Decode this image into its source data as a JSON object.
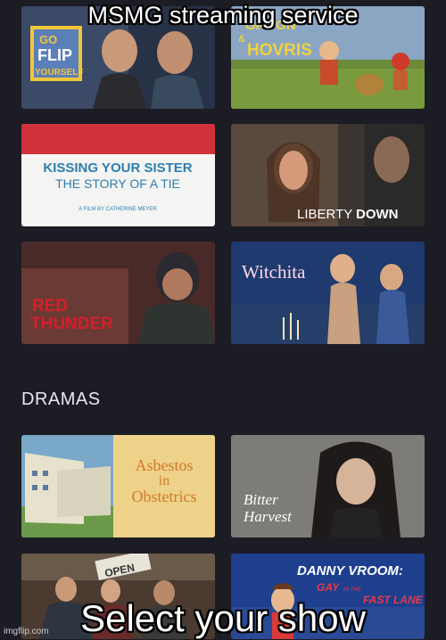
{
  "meme": {
    "top_text": "MSMG streaming service",
    "bottom_text": "Select your show"
  },
  "sections": {
    "dramas_label": "DRAMAS"
  },
  "tiles": {
    "flip": {
      "line1": "GO",
      "line2": "FLIP",
      "line3": "YOURSELF"
    },
    "grogn": {
      "line1": "GROGN",
      "line2": "&",
      "line3": "HOVRIS"
    },
    "kissing": {
      "line1": "KISSING YOUR SISTER",
      "line2": "THE STORY OF A TIE",
      "line3": "A FILM BY CATHERINE MEYER"
    },
    "liberty": {
      "part1": "LIBERTY",
      "part2": "DOWN"
    },
    "red": {
      "line1": "RED",
      "line2": "THUNDER"
    },
    "witchita": {
      "title": "Witchita"
    },
    "asbestos": {
      "line1": "Asbestos",
      "line2": "in",
      "line3": "Obstetrics"
    },
    "bitter": {
      "line1": "Bitter",
      "line2": "Harvest"
    },
    "protest": {
      "sign": "OPEN"
    },
    "danny": {
      "title": "DANNY VROOM:",
      "line2": "GAY",
      "line3": "IN THE",
      "line4": "FAST LANE"
    }
  },
  "watermark": "imgflip.com",
  "colors": {
    "background": "#1c1c24",
    "section_text": "#e8e8ee",
    "kissing_red": "#d0313a",
    "kissing_blue": "#2d7fb0",
    "red_thunder": "#d3202a"
  }
}
